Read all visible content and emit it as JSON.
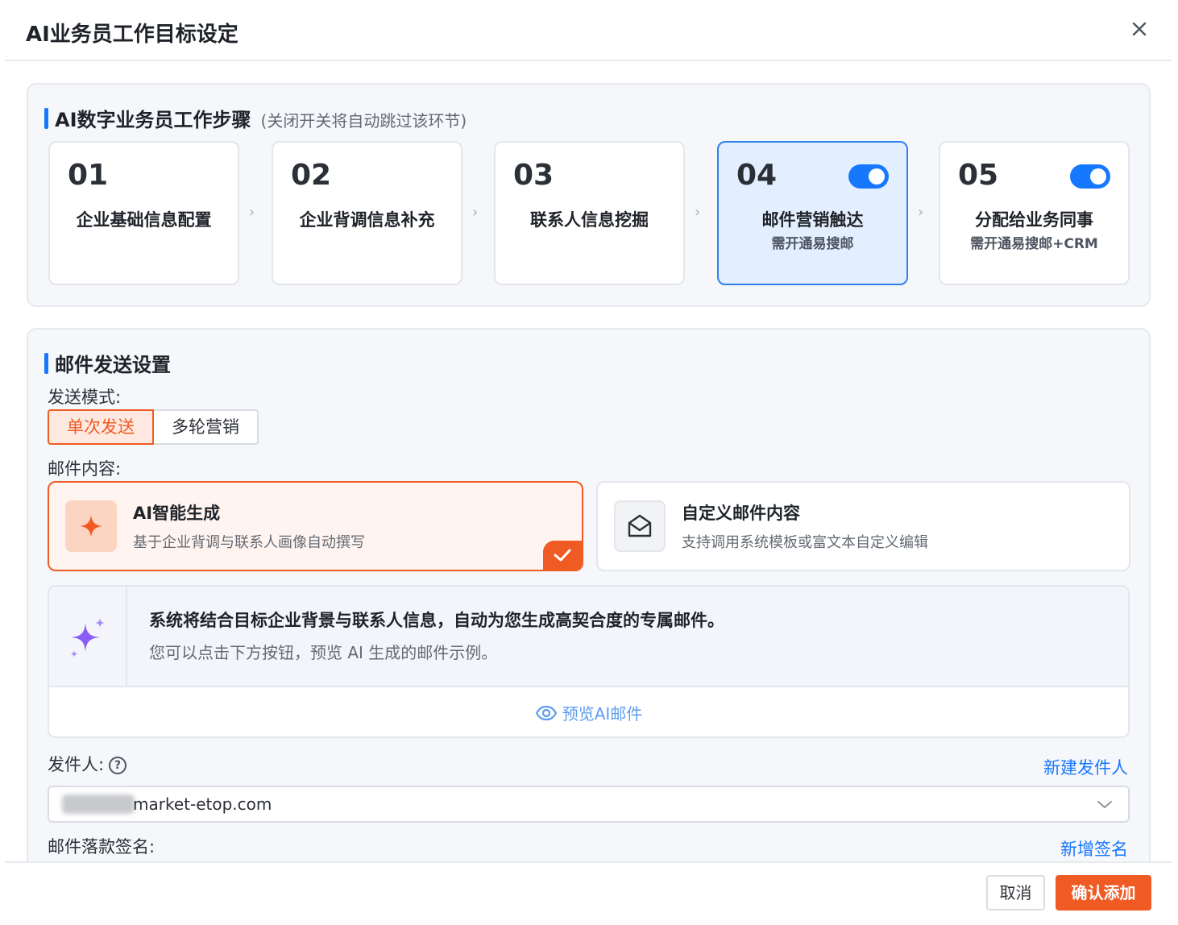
{
  "modal": {
    "title": "AI业务员工作目标设定"
  },
  "steps_section": {
    "title": "AI数字业务员工作步骤",
    "note": "(关闭开关将自动跳过该环节)",
    "steps": [
      {
        "num": "01",
        "label": "企业基础信息配置",
        "sub": "",
        "toggle": null
      },
      {
        "num": "02",
        "label": "企业背调信息补充",
        "sub": "",
        "toggle": null
      },
      {
        "num": "03",
        "label": "联系人信息挖掘",
        "sub": "",
        "toggle": null
      },
      {
        "num": "04",
        "label": "邮件营销触达",
        "sub": "需开通易搜邮",
        "toggle": "on"
      },
      {
        "num": "05",
        "label": "分配给业务同事",
        "sub": "需开通易搜邮+CRM",
        "toggle": "on"
      }
    ],
    "active_step": "04",
    "arrow": "›"
  },
  "email_section": {
    "title": "邮件发送设置",
    "send_mode_label": "发送模式:",
    "send_modes": [
      "单次发送",
      "多轮营销"
    ],
    "selected_mode": "单次发送",
    "content_label": "邮件内容:",
    "content_options": [
      {
        "title": "AI智能生成",
        "desc": "基于企业背调与联系人画像自动撰写",
        "icon": "sparkle-icon",
        "selected": true
      },
      {
        "title": "自定义邮件内容",
        "desc": "支持调用系统模板或富文本自定义编辑",
        "icon": "envelope-open-icon",
        "selected": false
      }
    ],
    "ai_info": {
      "main": "系统将结合目标企业背景与联系人信息，自动为您生成高契合度的专属邮件。",
      "sub": "您可以点击下方按钮，预览 AI 生成的邮件示例。",
      "preview_label": "预览AI邮件"
    },
    "sender_label": "发件人:",
    "new_sender_link": "新建发件人",
    "sender_value": "market-etop.com",
    "signature_label": "邮件落款签名:",
    "new_signature_link": "新增签名"
  },
  "footer": {
    "cancel_label": "取消",
    "confirm_label": "确认添加"
  },
  "colors": {
    "primary_blue": "#1677ff",
    "accent_orange": "#f05a23",
    "active_step_bg": "#e3efff",
    "panel_bg": "#f5f7fa"
  }
}
